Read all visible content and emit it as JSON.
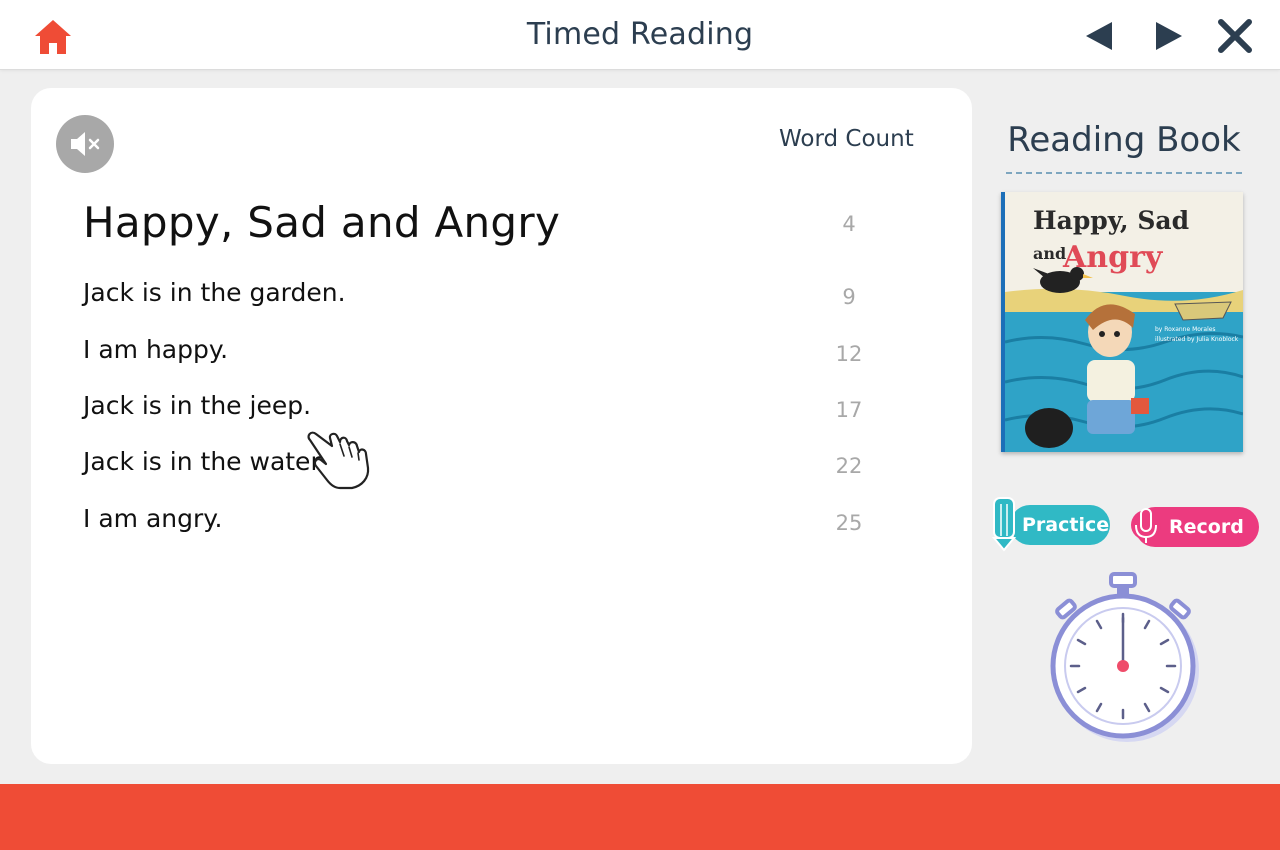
{
  "header": {
    "title": "Timed Reading",
    "icons": {
      "home": "home-icon",
      "prev": "triangle-left-icon",
      "next": "triangle-right-icon",
      "close": "close-icon"
    }
  },
  "reading": {
    "mute_icon": "speaker-muted-icon",
    "word_count_label": "Word Count",
    "title": "Happy, Sad and Angry",
    "title_count": "4",
    "lines": [
      {
        "text": "Jack is in the garden.",
        "count": "9"
      },
      {
        "text": "I am happy.",
        "count": "12"
      },
      {
        "text": "Jack is in the jeep.",
        "count": "17"
      },
      {
        "text": "Jack is in the water.",
        "count": "22"
      },
      {
        "text": "I am angry.",
        "count": "25"
      }
    ]
  },
  "side": {
    "title": "Reading Book",
    "cover": {
      "title_line1": "Happy, Sad",
      "title_and": "and",
      "title_line2": "Angry",
      "author": "by Roxanne Morales",
      "illustrator": "illustrated by Julia Knoblock"
    },
    "practice_label": "Practice",
    "record_label": "Record",
    "timer_icon": "stopwatch-icon"
  },
  "colors": {
    "accent_orange": "#ef4c36",
    "practice": "#30b9c5",
    "record": "#ec3b7f",
    "heading": "#2c3e50"
  }
}
